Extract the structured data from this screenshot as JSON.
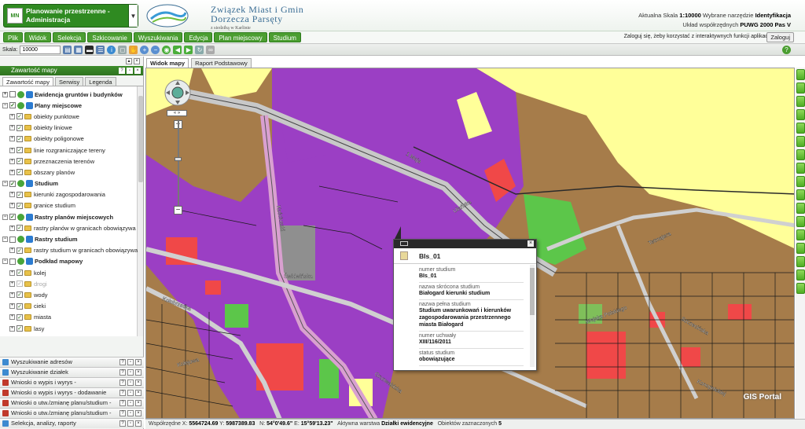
{
  "header": {
    "app_name": "Planowanie przestrzenne - Administracja",
    "app_badge": "MN",
    "org_line1": "Związek Miast i Gmin",
    "org_line2": "Dorzecza Parsęty",
    "org_line3": "z siedzibą w Karlinie",
    "scale_label": "Aktualna Skala",
    "scale_value": "1:10000",
    "tool_label": "Wybrane narzędzie",
    "tool_value": "Identyfikacja",
    "crs_label": "Układ współrzędnych",
    "crs_value": "PUWG 2000 Pas V"
  },
  "menu": [
    "Plik",
    "Widok",
    "Selekcja",
    "Szkicowanie",
    "Wyszukiwania",
    "Edycja",
    "Plan miejscowy",
    "Studium"
  ],
  "login": {
    "text": "Zaloguj się, żeby korzystać z interaktywnych funkcji aplikacji",
    "button": "Zaloguj"
  },
  "toolbar": {
    "scale_label": "Skala:",
    "scale_value": "10000"
  },
  "left_panel": {
    "title": "Zawartość mapy",
    "tabs": [
      "Zawartość mapy",
      "Serwisy",
      "Legenda"
    ],
    "tree": [
      {
        "label": "Ewidencja gruntów i budynków",
        "level": 0,
        "group": true,
        "checked": false,
        "exp": "+"
      },
      {
        "label": "Plany miejscowe",
        "level": 0,
        "group": true,
        "checked": true,
        "exp": "−"
      },
      {
        "label": "obiekty punktowe",
        "level": 1,
        "checked": true,
        "exp": "+"
      },
      {
        "label": "obiekty liniowe",
        "level": 1,
        "checked": true,
        "exp": "+"
      },
      {
        "label": "obiekty poligonowe",
        "level": 1,
        "checked": true,
        "exp": "+"
      },
      {
        "label": "linie rozgraniczające tereny",
        "level": 1,
        "checked": true,
        "exp": "+"
      },
      {
        "label": "przeznaczenia terenów",
        "level": 1,
        "checked": true,
        "exp": "+"
      },
      {
        "label": "obszary planów",
        "level": 1,
        "checked": true,
        "exp": "+"
      },
      {
        "label": "Studium",
        "level": 0,
        "group": true,
        "checked": true,
        "exp": "−"
      },
      {
        "label": "kierunki zagospodarowania",
        "level": 1,
        "checked": true,
        "exp": "+"
      },
      {
        "label": "granice studium",
        "level": 1,
        "checked": true,
        "exp": "+"
      },
      {
        "label": "Rastry planów miejscowych",
        "level": 0,
        "group": true,
        "checked": true,
        "exp": "−"
      },
      {
        "label": "rastry planów w granicach obowiązywa",
        "level": 1,
        "checked": true,
        "exp": "+"
      },
      {
        "label": "Rastry studium",
        "level": 0,
        "group": true,
        "checked": false,
        "exp": "−"
      },
      {
        "label": "rastry studium w granicach obowiązywa",
        "level": 1,
        "checked": true,
        "exp": "+"
      },
      {
        "label": "Podkład mapowy",
        "level": 0,
        "group": true,
        "checked": false,
        "exp": "−"
      },
      {
        "label": "kolej",
        "level": 1,
        "checked": true,
        "exp": "+"
      },
      {
        "label": "drogi",
        "level": 1,
        "checked": true,
        "exp": "+",
        "disabled": true
      },
      {
        "label": "wody",
        "level": 1,
        "checked": true,
        "exp": "+"
      },
      {
        "label": "cieki",
        "level": 1,
        "checked": true,
        "exp": "+"
      },
      {
        "label": "miasta",
        "level": 1,
        "checked": true,
        "exp": "+"
      },
      {
        "label": "lasy",
        "level": 1,
        "checked": true,
        "exp": "+"
      }
    ],
    "bottom_panels": [
      "Wyszukiwanie adresów",
      "Wyszukiwanie działek",
      "Wnioski o wypis i wyrys -",
      "Wnioski o wypis i wyrys - dodawanie",
      "Wnioski o utw./zmianę planu/studium -",
      "Wnioski o utw./zmianę planu/studium -",
      "Selekcja, analizy, raporty"
    ]
  },
  "map_tabs": [
    "Widok mapy",
    "Raport Podstawowy"
  ],
  "popup": {
    "title": "BIs_01",
    "fields": [
      {
        "k": "numer studium",
        "v": "BIs_01"
      },
      {
        "k": "nazwa skrócona studium",
        "v": "Białogard kierunki studium"
      },
      {
        "k": "nazwa pełna studium",
        "v": "Studium uwarunkowań i kierunków zagospodarowania przestrzennego miasta Białogard"
      },
      {
        "k": "numer uchwały",
        "v": "XIII/116/2011"
      },
      {
        "k": "status studium",
        "v": "obowiązujące"
      }
    ]
  },
  "map_labels": [
    "1 Maja",
    "Ułańska",
    "Świdwińska",
    "Kościuszki",
    "Grunwaldzka",
    "Kołobrzeska",
    "Tetmajera",
    "Wojska Polskiego",
    "Szczecińska",
    "Kolejowa",
    "Konopnickiej"
  ],
  "status": {
    "coord_label": "Współrzędne",
    "x": "5564724.69",
    "y": "5987389.83",
    "n": "54°0'49.6\"",
    "e": "15°59'13.23\"",
    "active_label": "Aktywna warstwa",
    "active_value": "Działki ewidencyjne",
    "selected_label": "Obiektów zaznaczonych",
    "selected_value": "5"
  },
  "watermark": "GIS Portal",
  "colors": {
    "brand_green": "#4b9e31",
    "purple": "#9b3fc4",
    "brown": "#a88450",
    "red": "#f04848",
    "yellow": "#ffff99"
  }
}
